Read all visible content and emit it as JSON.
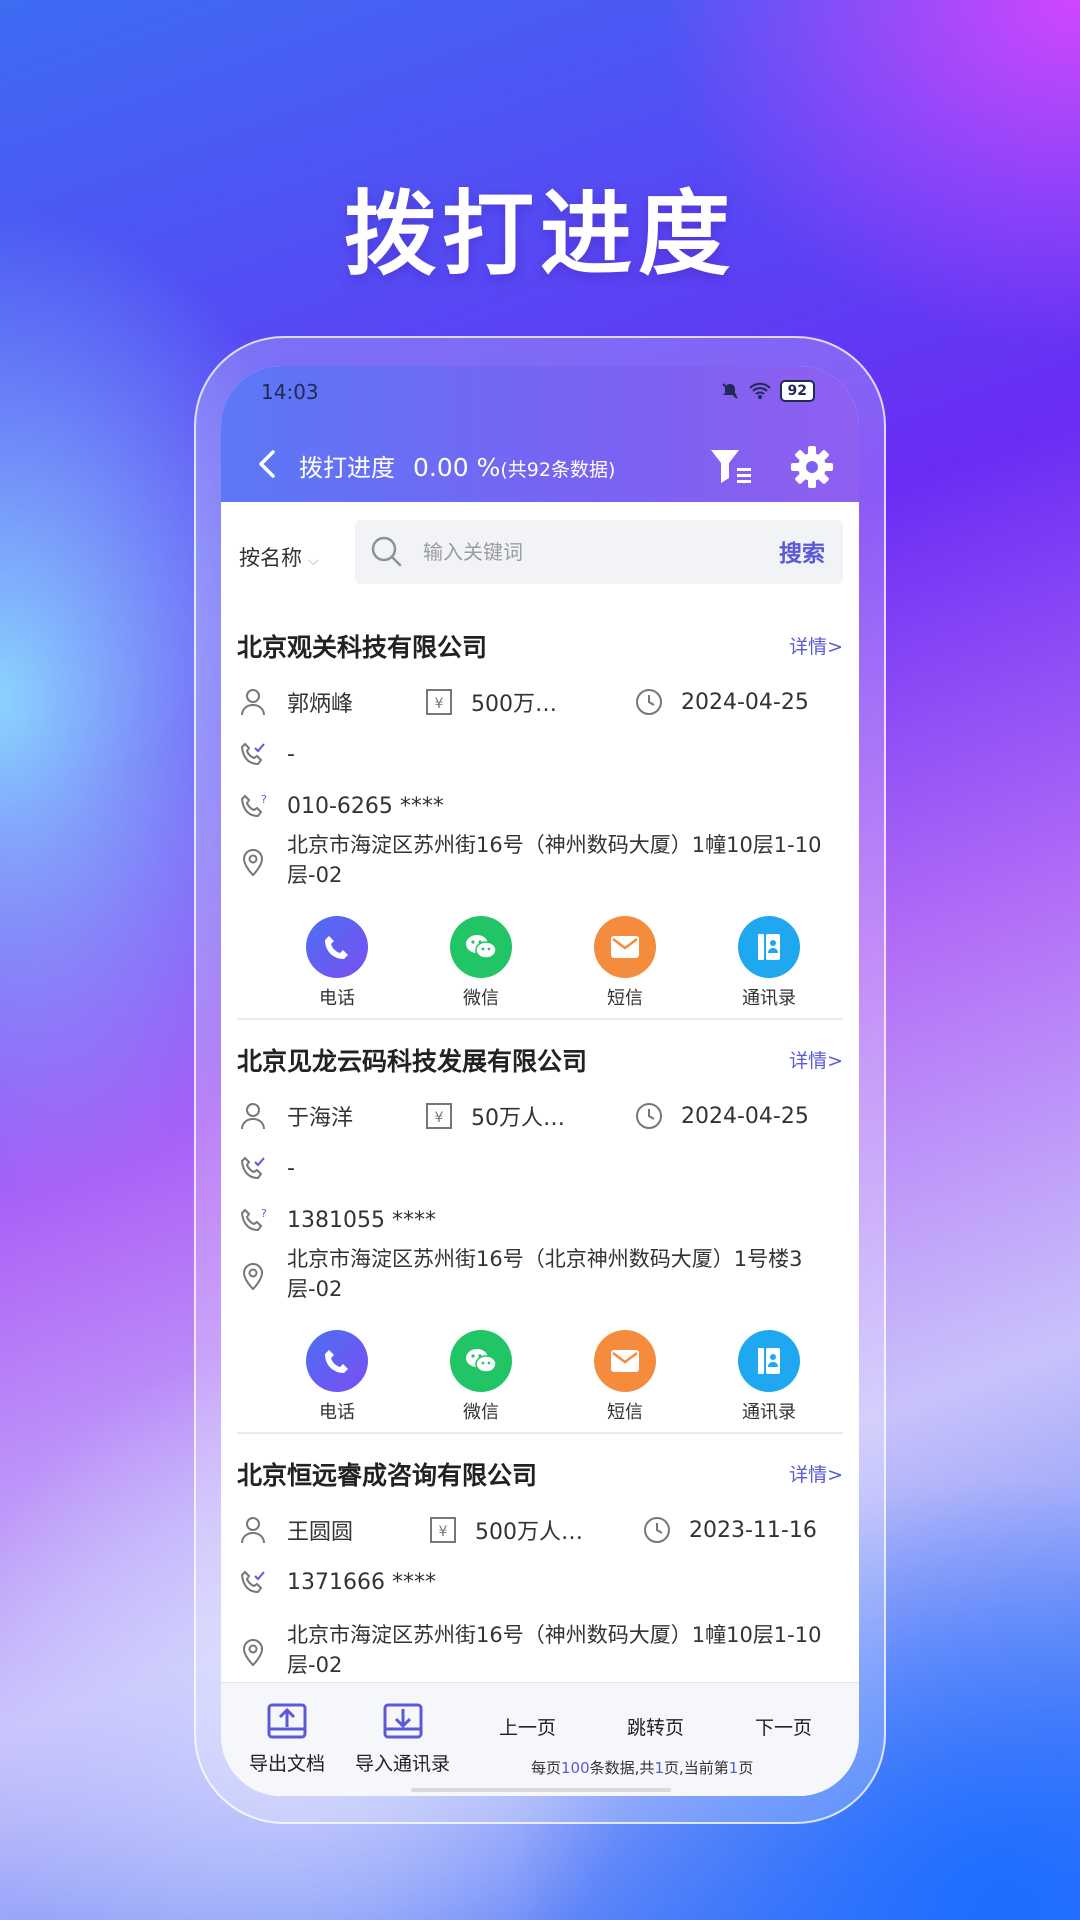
{
  "headline": "拨打进度",
  "status": {
    "time": "14:03",
    "battery": "92"
  },
  "header": {
    "title": "拨打进度",
    "percent": "0.00 %",
    "count": "(共92条数据)"
  },
  "search": {
    "sort_label": "按名称",
    "placeholder": "输入关键词",
    "button": "搜索"
  },
  "companies": [
    {
      "name": "北京观关科技有限公司",
      "detail": "详情>",
      "person": "郭炳峰",
      "capital": "500万…",
      "date": "2024-04-25",
      "called": "-",
      "phone": "010-6265 ****",
      "address": "北京市海淀区苏州街16号（神州数码大厦）1幢10层1-10层-02"
    },
    {
      "name": "北京见龙云码科技发展有限公司",
      "detail": "详情>",
      "person": "于海洋",
      "capital": "50万人…",
      "date": "2024-04-25",
      "called": "-",
      "phone": "1381055 ****",
      "address": "北京市海淀区苏州街16号（北京神州数码大厦）1号楼3层-02"
    },
    {
      "name": "北京恒远睿成咨询有限公司",
      "detail": "详情>",
      "person": "王圆圆",
      "capital": "500万人…",
      "date": "2023-11-16",
      "phone": "1371666 ****",
      "address": "北京市海淀区苏州街16号（神州数码大厦）1幢10层1-10层-02"
    }
  ],
  "actions": {
    "call": "电话",
    "wechat": "微信",
    "sms": "短信",
    "contacts": "通讯录"
  },
  "colors": {
    "call": "#5b5cf0",
    "wechat": "#22c565",
    "sms": "#f58b3c",
    "contacts": "#1fa8f0",
    "accent": "#5a5ad8"
  },
  "bottom": {
    "export": "导出文档",
    "import": "导入通讯录",
    "prev": "上一页",
    "jump": "跳转页",
    "next": "下一页",
    "info_a": "每页",
    "per_page": "100",
    "info_b": "条数据,共",
    "total_pages": "1",
    "info_c": "页,当前第",
    "current_page": "1",
    "info_d": "页"
  }
}
